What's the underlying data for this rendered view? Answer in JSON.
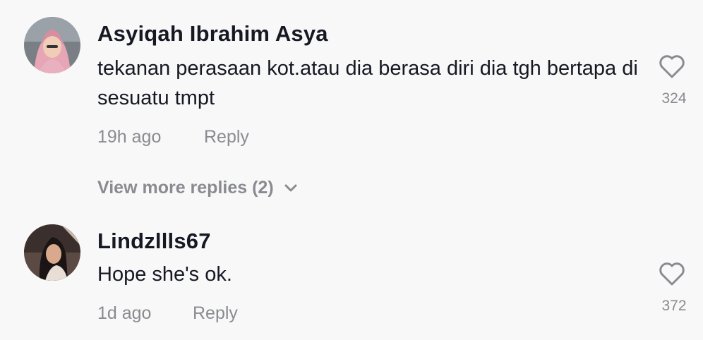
{
  "comments": [
    {
      "username": "Asyiqah Ibrahim Asya",
      "text": "tekanan perasaan kot.atau dia berasa diri dia tgh bertapa di sesuatu tmpt",
      "time": "19h ago",
      "reply_label": "Reply",
      "likes": "324",
      "avatar_icon": "avatar-hijab-woman"
    },
    {
      "username": "Lindzllls67",
      "text": "Hope she's ok.",
      "time": "1d ago",
      "reply_label": "Reply",
      "likes": "372",
      "avatar_icon": "avatar-woman-dark-hair"
    }
  ],
  "view_more_replies": "View more replies (2)",
  "colors": {
    "background": "#f8f8f8",
    "text": "#161823",
    "secondary": "#8a8b91"
  }
}
